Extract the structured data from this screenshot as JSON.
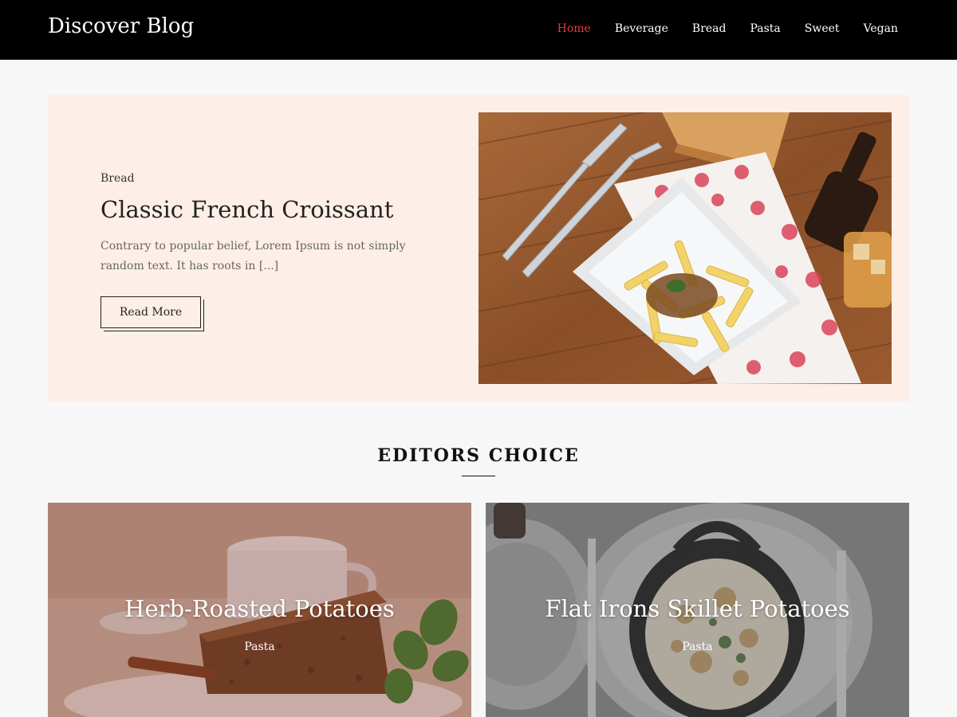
{
  "header": {
    "site_title": "Discover Blog",
    "nav": [
      {
        "label": "Home",
        "active": true
      },
      {
        "label": "Beverage"
      },
      {
        "label": "Bread"
      },
      {
        "label": "Pasta"
      },
      {
        "label": "Sweet"
      },
      {
        "label": "Vegan"
      }
    ],
    "accent_color": "#e23b3b"
  },
  "hero": {
    "category": "Bread",
    "title": "Classic French Croissant",
    "excerpt": "Contrary to popular belief, Lorem Ipsum is not simply random text. It has roots in [...]",
    "read_more_label": "Read More",
    "background_color": "#fdefe8"
  },
  "editors_choice": {
    "heading": "EDITORS CHOICE",
    "cards": [
      {
        "title": "Herb-Roasted Potatoes",
        "category": "Pasta"
      },
      {
        "title": "Flat Irons Skillet Potatoes",
        "category": "Pasta"
      }
    ]
  }
}
